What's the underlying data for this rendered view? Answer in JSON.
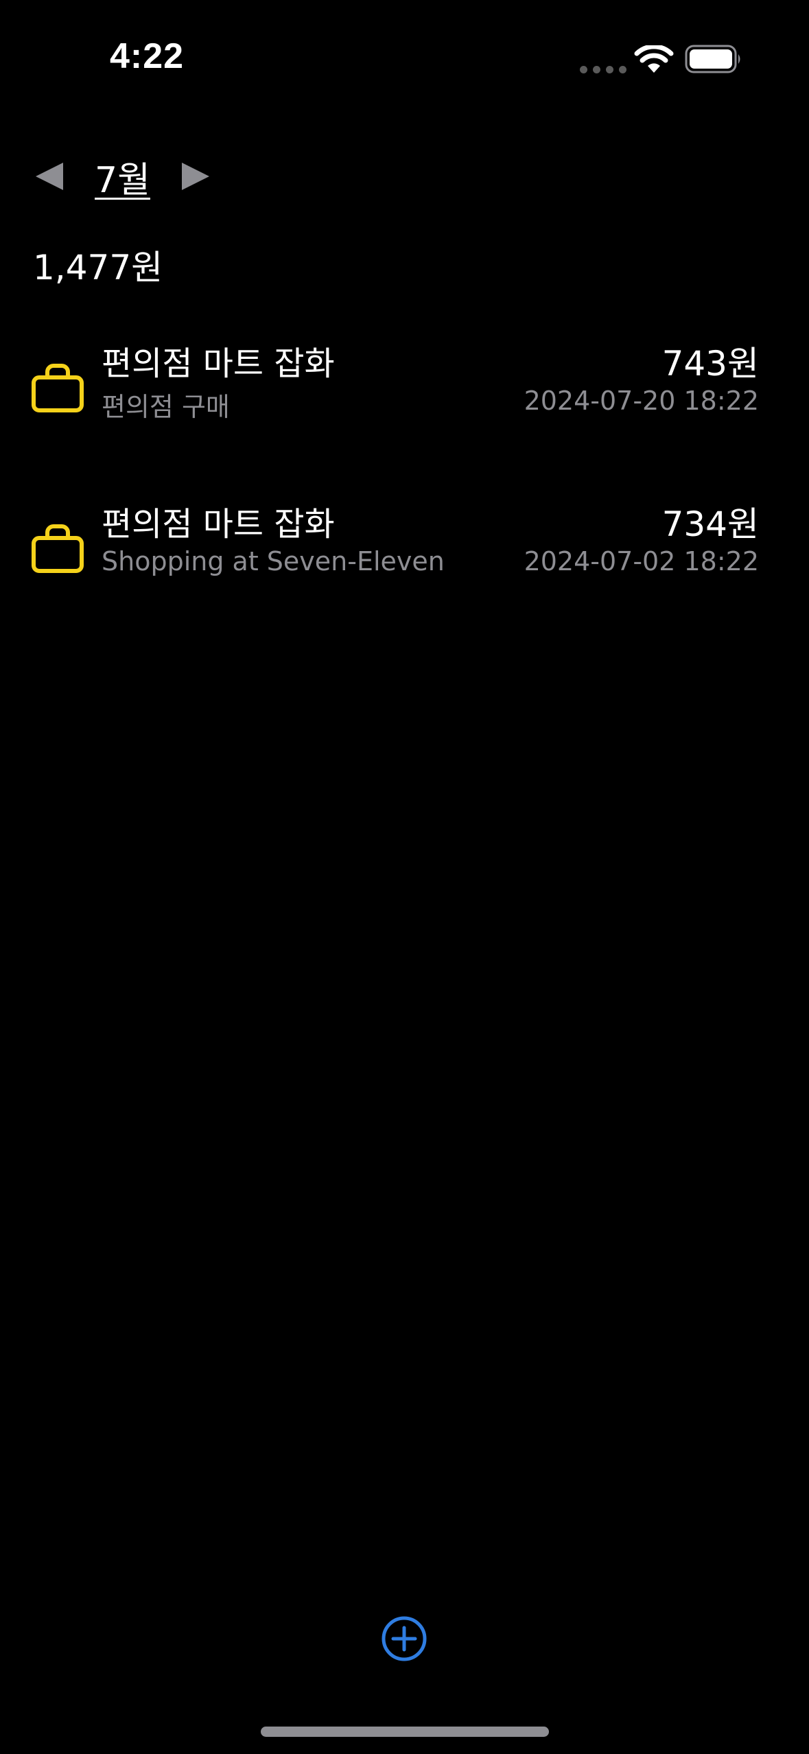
{
  "status_bar": {
    "time": "4:22"
  },
  "header": {
    "month_label": "7월",
    "prev_icon": "triangle-left-icon",
    "next_icon": "triangle-right-icon"
  },
  "summary": {
    "total": "1,477원"
  },
  "transactions": [
    {
      "icon": "bag-icon",
      "title": "편의점 마트 잡화",
      "subtitle": "편의점 구매",
      "amount": "743원",
      "datetime": "2024-07-20 18:22"
    },
    {
      "icon": "bag-icon",
      "title": "편의점 마트 잡화",
      "subtitle": "Shopping at Seven-Eleven",
      "amount": "734원",
      "datetime": "2024-07-02 18:22"
    }
  ],
  "colors": {
    "background": "#000000",
    "text_primary": "#ffffff",
    "text_secondary": "#8e8e93",
    "category_icon": "#f5d21a",
    "accent": "#2f7de1"
  },
  "footer": {
    "add_icon": "plus-circle-icon"
  }
}
